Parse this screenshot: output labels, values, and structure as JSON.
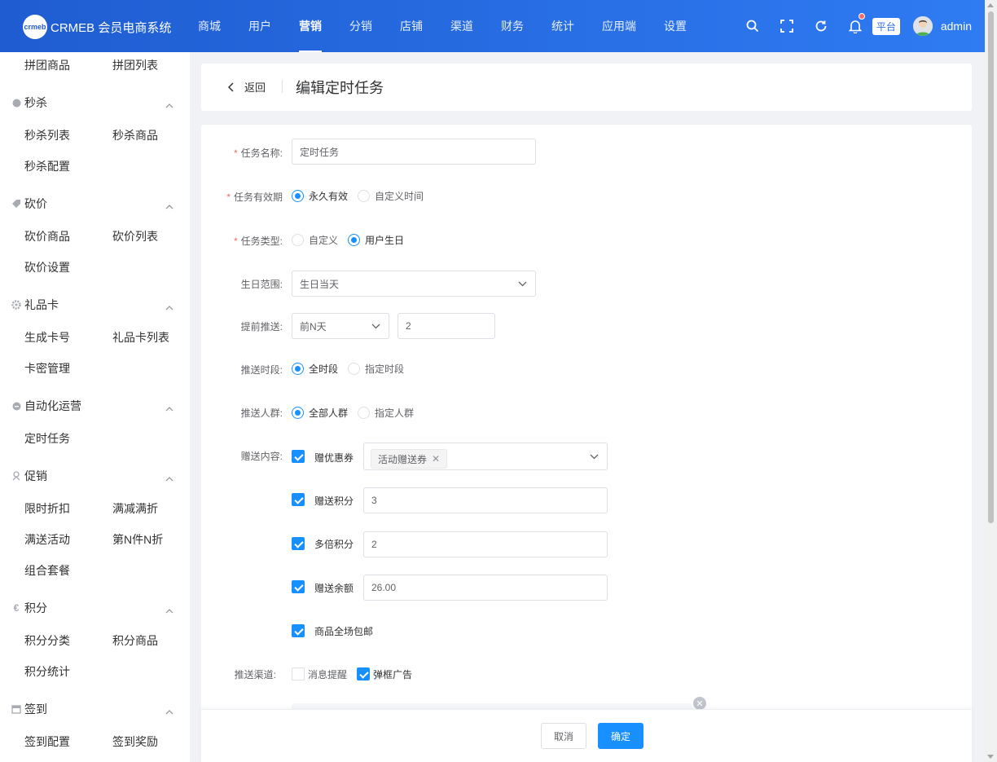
{
  "header": {
    "logo_mark": "crmeb",
    "logo_text": "CRMEB 会员电商系统",
    "nav": [
      "商城",
      "用户",
      "营销",
      "分销",
      "店铺",
      "渠道",
      "财务",
      "统计",
      "应用端",
      "设置"
    ],
    "active_nav": "营销",
    "platform_badge": "平台",
    "username": "admin",
    "icons": [
      "search-icon",
      "fullscreen-icon",
      "refresh-icon",
      "bell-icon"
    ]
  },
  "sidebar": {
    "top_links": [
      "拼团商品",
      "拼团列表"
    ],
    "groups": [
      {
        "title": "秒杀",
        "icon": "clock-icon",
        "links": [
          "秒杀列表",
          "秒杀商品",
          "秒杀配置"
        ]
      },
      {
        "title": "砍价",
        "icon": "tag-icon",
        "links": [
          "砍价商品",
          "砍价列表",
          "砍价设置"
        ]
      },
      {
        "title": "礼品卡",
        "icon": "gear-icon",
        "links": [
          "生成卡号",
          "礼品卡列表",
          "卡密管理"
        ]
      },
      {
        "title": "自动化运营",
        "icon": "circle-icon",
        "links": [
          "定时任务"
        ]
      },
      {
        "title": "促销",
        "icon": "promo-icon",
        "links": [
          "限时折扣",
          "满减满折",
          "满送活动",
          "第N件N折",
          "组合套餐"
        ]
      },
      {
        "title": "积分",
        "icon": "euro-icon",
        "links": [
          "积分分类",
          "积分商品",
          "积分统计"
        ]
      },
      {
        "title": "签到",
        "icon": "calendar-icon",
        "links": [
          "签到配置",
          "签到奖励"
        ]
      }
    ]
  },
  "page": {
    "back_label": "返回",
    "title": "编辑定时任务"
  },
  "form": {
    "task_name": {
      "label": "任务名称:",
      "value": "定时任务"
    },
    "validity": {
      "label": "任务有效期",
      "options": [
        "永久有效",
        "自定义时间"
      ],
      "selected": "永久有效"
    },
    "task_type": {
      "label": "任务类型:",
      "options": [
        "自定义",
        "用户生日"
      ],
      "selected": "用户生日"
    },
    "birthday_range": {
      "label": "生日范围:",
      "value": "生日当天"
    },
    "advance_push": {
      "label": "提前推送:",
      "select_value": "前N天",
      "days_value": "2"
    },
    "push_period": {
      "label": "推送时段:",
      "options": [
        "全时段",
        "指定时段"
      ],
      "selected": "全时段"
    },
    "push_crowd": {
      "label": "推送人群:",
      "options": [
        "全部人群",
        "指定人群"
      ],
      "selected": "全部人群"
    },
    "gift": {
      "label": "赠送内容:",
      "items": [
        {
          "label": "赠优惠券",
          "checked": true,
          "tag": "活动赠送券"
        },
        {
          "label": "赠送积分",
          "checked": true,
          "value": "3"
        },
        {
          "label": "多倍积分",
          "checked": true,
          "value": "2"
        },
        {
          "label": "赠送余额",
          "checked": true,
          "value": "26.00"
        },
        {
          "label": "商品全场包邮",
          "checked": true
        }
      ]
    },
    "channel": {
      "label": "推送渠道:",
      "options": [
        {
          "label": "消息提醒",
          "checked": false
        },
        {
          "label": "弹框广告",
          "checked": true
        }
      ]
    }
  },
  "footer": {
    "cancel": "取消",
    "confirm": "确定"
  },
  "colors": {
    "header_start": "#1f5cd1",
    "header_end": "#2f7bf2",
    "primary": "#1890ff",
    "required": "#f56c6c"
  }
}
